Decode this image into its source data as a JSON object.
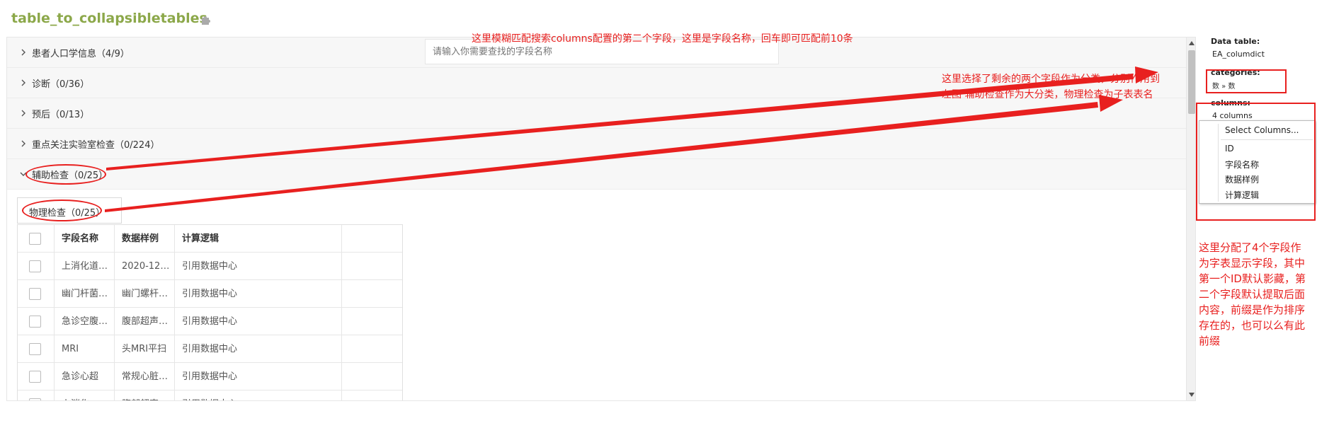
{
  "header": {
    "title": "table_to_collapsibletables",
    "icon": "puzzle-icon"
  },
  "search": {
    "placeholder": "请输入你需要查找的字段名称"
  },
  "accordion": [
    {
      "label": "患者人口学信息（4/9）",
      "expanded": false
    },
    {
      "label": "诊断（0/36）",
      "expanded": false
    },
    {
      "label": "预后（0/13）",
      "expanded": false
    },
    {
      "label": "重点关注实验室检查（0/224）",
      "expanded": false
    },
    {
      "label": "辅助检查（0/25）",
      "expanded": true
    }
  ],
  "subtab": {
    "label": "物理检查（0/25）"
  },
  "table": {
    "headers": [
      "字段名称",
      "数据样例",
      "计算逻辑"
    ],
    "rows": [
      [
        "上消化道…",
        "2020-12…",
        "引用数据中心"
      ],
      [
        "幽门杆菌…",
        "幽门螺杆…",
        "引用数据中心"
      ],
      [
        "急诊空腹…",
        "腹部超声…",
        "引用数据中心"
      ],
      [
        "MRI",
        "头MRI平扫",
        "引用数据中心"
      ],
      [
        "急诊心超",
        "常规心脏…",
        "引用数据中心"
      ],
      [
        "上消化…",
        "腹部超声…",
        "引用数据中心"
      ]
    ]
  },
  "sidebar": {
    "data_table_label": "Data table:",
    "data_table_value": "EA_columdict",
    "categories_label": "categories:",
    "categories_value": "数  »  数",
    "columns_label": "columns:",
    "columns_count": "4 columns",
    "dropdown_header": "Select Columns...",
    "dropdown_options": [
      "ID",
      "字段名称",
      "数据样例",
      "计算逻辑"
    ]
  },
  "annotations": {
    "search_note": "这里模糊匹配搜索columns配置的第二个字段，这里是字段名称，回车即可匹配前10条",
    "category_note_1": "这里选择了剩余的两个字段作为分类，分别作用到",
    "category_note_2": "左图 辅助检查作为大分类，物理检查为子表表名",
    "columns_note": [
      "这里分配了4个字段作",
      "为字表显示字段，其中",
      "第一个ID默认影藏，第",
      "二个字段默认提取后面",
      "内容，前缀是作为排序",
      "存在的，也可以么有此",
      "前缀"
    ]
  },
  "colors": {
    "title": "#8ca84a",
    "annotation": "#e8201f"
  }
}
